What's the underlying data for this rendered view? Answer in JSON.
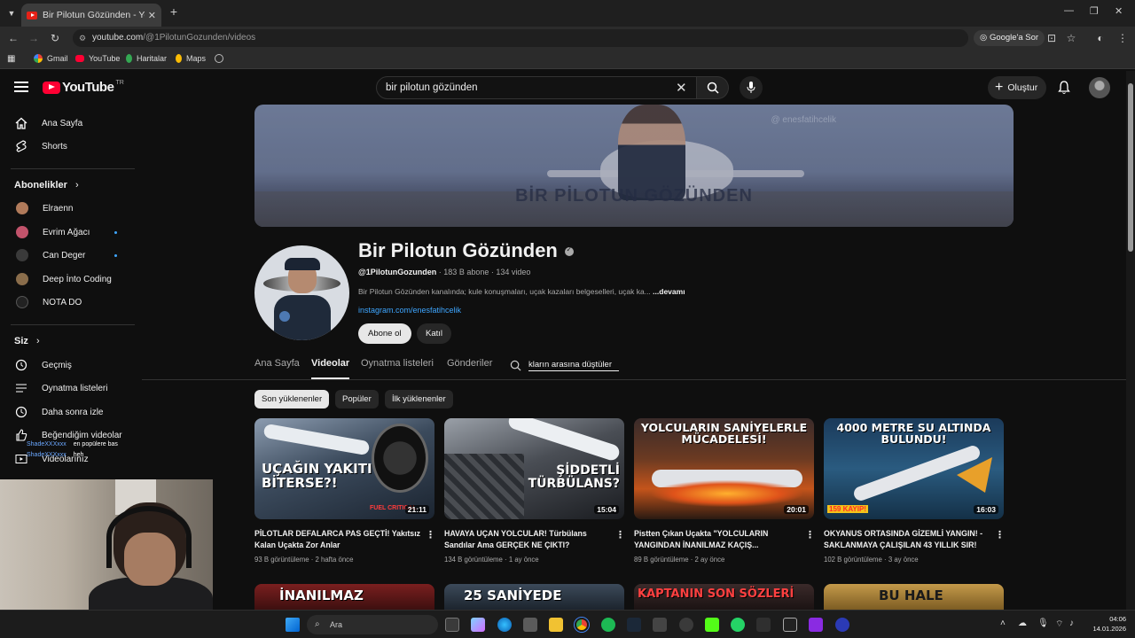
{
  "browser": {
    "tab_title": "Bir Pilotun Gözünden - YouTube",
    "url_host": "youtube.com",
    "url_path": "/@1PilotunGozunden/videos",
    "google_ask": "Google'a Sor",
    "bookmarks": [
      "Gmail",
      "YouTube",
      "Haritalar",
      "Maps"
    ]
  },
  "masthead": {
    "logo": "YouTube",
    "country": "TR",
    "search_value": "bir pilotun gözünden",
    "create_label": "Oluştur"
  },
  "sidebar": {
    "main": [
      {
        "label": "Ana Sayfa",
        "icon": "home-icon"
      },
      {
        "label": "Shorts",
        "icon": "shorts-icon"
      }
    ],
    "subs_heading": "Abonelikler",
    "subscriptions": [
      {
        "label": "Elraenn",
        "color": "#b07a5a",
        "new": false
      },
      {
        "label": "Evrim Ağacı",
        "color": "#c2536b",
        "new": true
      },
      {
        "label": "Can Deger",
        "color": "#3a3a3a",
        "new": true
      },
      {
        "label": "Deep İnto Coding",
        "color": "#8a6d4b",
        "new": false
      },
      {
        "label": "NOTA DO",
        "color": "#222222",
        "new": false
      }
    ],
    "you_heading": "Siz",
    "you": [
      {
        "label": "Geçmiş",
        "icon": "history-icon"
      },
      {
        "label": "Oynatma listeleri",
        "icon": "playlist-icon"
      },
      {
        "label": "Daha sonra izle",
        "icon": "watch-later-icon"
      },
      {
        "label": "Beğendiğim videolar",
        "icon": "like-icon"
      },
      {
        "label": "Videolarınız",
        "icon": "your-videos-icon"
      }
    ]
  },
  "banner": {
    "title": "BİR PİLOTUN GÖZÜNDEN",
    "handle": "@ enesfatihcelik"
  },
  "channel": {
    "name": "Bir Pilotun Gözünden",
    "handle": "@1PilotunGozunden",
    "subscribers": "183 B abone",
    "videos": "134 video",
    "description": "Bir Pilotun Gözünden kanalında; kule konuşmaları, uçak kazaları belgeselleri, uçak ka...",
    "more": "...devamı",
    "link": "instagram.com/enesfatihcelik",
    "subscribe_label": "Abone ol",
    "join_label": "Katıl"
  },
  "tabs": [
    {
      "label": "Ana Sayfa",
      "active": false
    },
    {
      "label": "Videolar",
      "active": true
    },
    {
      "label": "Oynatma listeleri",
      "active": false
    },
    {
      "label": "Gönderiler",
      "active": false
    }
  ],
  "channel_search_value": "kların arasına düştüler",
  "chips": [
    {
      "label": "Son yüklenenler",
      "active": true
    },
    {
      "label": "Popüler",
      "active": false
    },
    {
      "label": "İlk yüklenenler",
      "active": false
    }
  ],
  "videos": [
    {
      "thumb_text": "UÇAĞIN YAKITI BİTERSE?!",
      "thumb_sub": "FUEL CRITICAL",
      "duration": "21:11",
      "title": "PİLOTLAR DEFALARCA PAS GEÇTİ! Yakıtsız Kalan Uçakta Zor Anlar",
      "views": "93 B görüntüleme",
      "age": "2 hafta önce"
    },
    {
      "thumb_text": "ŞİDDETLİ TÜRBÜLANS?",
      "duration": "15:04",
      "title": "HAVAYA UÇAN YOLCULAR! Türbülans Sandılar Ama GERÇEK NE ÇIKTI?",
      "views": "134 B görüntüleme",
      "age": "1 ay önce"
    },
    {
      "thumb_text": "YOLCULARIN SANİYELERLE MÜCADELESİ!",
      "duration": "20:01",
      "title": "Pistten Çıkan Uçakta \"YOLCULARIN YANGINDAN İNANILMAZ KAÇIŞ...",
      "views": "89 B görüntüleme",
      "age": "2 ay önce"
    },
    {
      "thumb_text": "4000 METRE SU ALTINDA BULUNDU!",
      "thumb_sub": "159 KAYIP!",
      "duration": "16:03",
      "title": "OKYANUS ORTASINDA GİZEMLİ YANGIN! - SAKLANMAYA ÇALIŞILAN 43 YILLIK SIR!",
      "views": "102 B görüntüleme",
      "age": "3 ay önce"
    }
  ],
  "videos_row2": [
    "İNANILMAZ",
    "25 SANİYEDE",
    "KAPTANIN SON SÖZLERİ",
    "BU HALE"
  ],
  "overlay_chat": [
    {
      "user": "ShadeXXXxxx",
      "msg": "en popülere bas"
    },
    {
      "user": "ShadeXXXxxx",
      "msg": "heh"
    }
  ],
  "taskbar": {
    "search_placeholder": "Ara",
    "time": "04:06",
    "date": "14.01.2026"
  },
  "colors": {
    "accent": "#ff0033",
    "link": "#3ea6ff",
    "background": "#0f0f0f"
  }
}
